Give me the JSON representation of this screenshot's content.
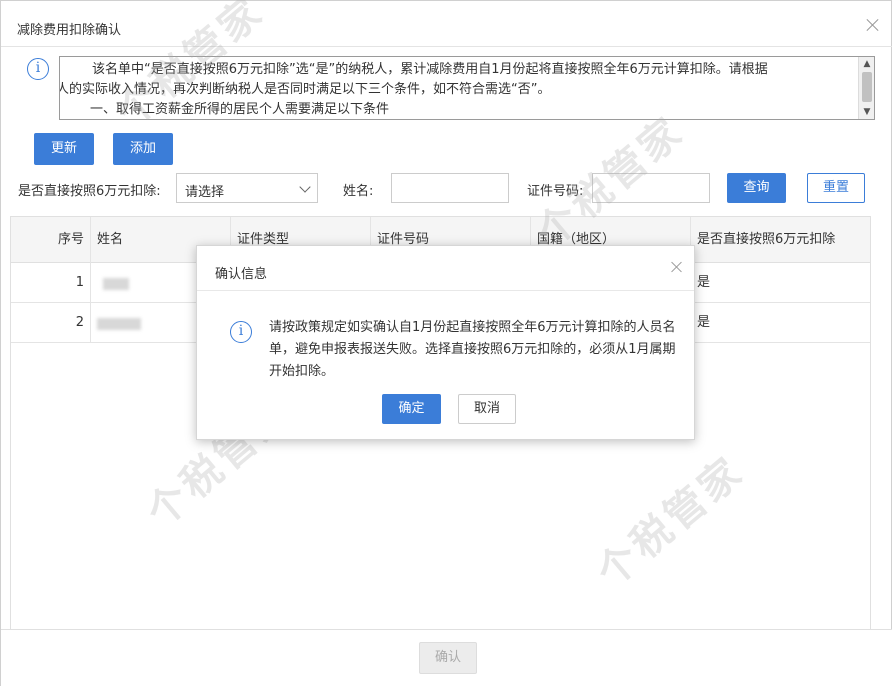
{
  "dialog": {
    "title": "减除费用扣除确认",
    "notice": {
      "line1": "该名单中“是否直接按照6万元扣除”选“是”的纳税人，累计减除费用自1月份起将直接按照全年6万元计算扣除。请根据",
      "line2": "纳税人的实际收入情况，再次判断纳税人是否同时满足以下三个条件，如不符合需选“否”。",
      "line3": "一、取得工资薪金所得的居民个人需要满足以下条件"
    },
    "buttons": {
      "update": "更新",
      "add": "添加"
    },
    "filters": {
      "deduct_label": "是否直接按照6万元扣除:",
      "deduct_value": "请选择",
      "name_label": "姓名:",
      "id_label": "证件号码:",
      "query": "查询",
      "reset": "重置"
    },
    "table": {
      "columns": [
        "序号",
        "姓名",
        "证件类型",
        "证件号码",
        "国籍（地区）",
        "是否直接按照6万元扣除"
      ],
      "rows": [
        {
          "index": "1",
          "deduct": "是"
        },
        {
          "index": "2",
          "deduct": "是"
        }
      ]
    },
    "footer_confirm": "确认"
  },
  "modal": {
    "title": "确认信息",
    "message": "请按政策规定如实确认自1月份起直接按照全年6万元计算扣除的人员名单，避免申报表报送失败。选择直接按照6万元扣除的，必须从1月属期开始扣除。",
    "ok": "确定",
    "cancel": "取消"
  },
  "watermark": "个税管家",
  "colors": {
    "accent": "#3b7dd8",
    "header_bg": "#f5f5f5"
  }
}
